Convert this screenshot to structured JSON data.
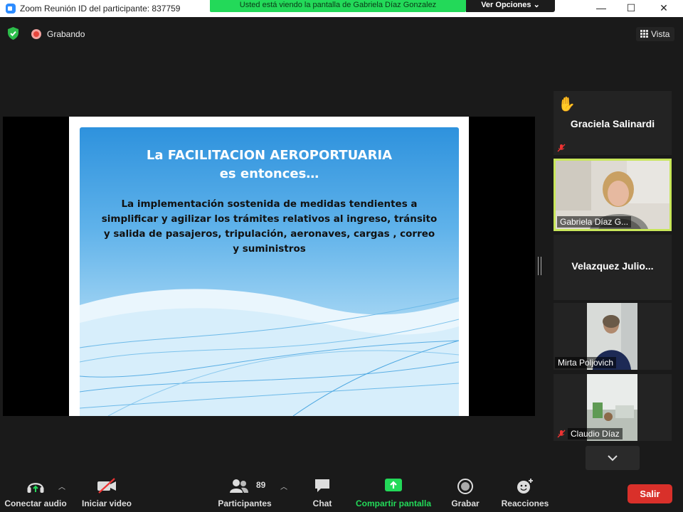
{
  "window": {
    "title": "Zoom Reunión ID del participante: 837759",
    "minimize": "—",
    "maximize": "☐",
    "close": "✕"
  },
  "banner": {
    "sharing_text": "Usted está viendo la pantalla de Gabriela Díaz Gonzalez",
    "view_options": "Ver Opciones ⌄"
  },
  "status": {
    "recording_label": "Grabando",
    "view_label": "Vista"
  },
  "slide": {
    "title": "La FACILITACION AEROPORTUARIA es entonces…",
    "body": "La implementación sostenida de medidas tendientes a simplificar y agilizar los trámites relativos al ingreso, tránsito y salida de pasajeros, tripulación, aeronaves, cargas , correo y suministros"
  },
  "participants": [
    {
      "name": "Graciela Salinardi",
      "hand_raised": true,
      "muted": true,
      "video": false
    },
    {
      "name": "Gabriela Díaz G...",
      "active_speaker": true,
      "video": true
    },
    {
      "name": "Velazquez  Julio...",
      "video": false
    },
    {
      "name": "Mirta Poljovich",
      "video": true
    },
    {
      "name": "Claudio Díaz",
      "muted": true,
      "video": true
    }
  ],
  "toolbar": {
    "audio": "Conectar audio",
    "video": "Iniciar video",
    "participants": "Participantes",
    "participants_count": "89",
    "chat": "Chat",
    "share": "Compartir pantalla",
    "record": "Grabar",
    "reactions": "Reacciones",
    "leave": "Salir"
  },
  "colors": {
    "share_green": "#23d959",
    "active_speaker_border": "#c8e65a",
    "leave_red": "#d9302a",
    "recording_red": "#e8453c"
  }
}
